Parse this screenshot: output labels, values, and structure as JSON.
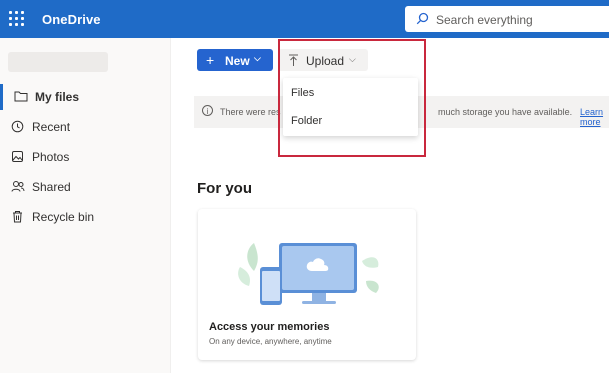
{
  "app": {
    "title": "OneDrive"
  },
  "search": {
    "placeholder": "Search everything"
  },
  "nav": {
    "items": [
      {
        "label": "My files",
        "icon": "folder-icon",
        "active": true
      },
      {
        "label": "Recent",
        "icon": "clock-icon",
        "active": false
      },
      {
        "label": "Photos",
        "icon": "photo-icon",
        "active": false
      },
      {
        "label": "Shared",
        "icon": "people-icon",
        "active": false
      },
      {
        "label": "Recycle bin",
        "icon": "trash-icon",
        "active": false
      }
    ]
  },
  "toolbar": {
    "new_label": "New",
    "upload_label": "Upload"
  },
  "upload_menu": {
    "items": [
      "Files",
      "Folder"
    ]
  },
  "notice": {
    "text_start": "There were res",
    "text_end": "much storage you have available.",
    "link": "Learn more"
  },
  "foryou": {
    "heading": "For you",
    "card_title": "Access your memories",
    "card_subtitle": "On any device, anywhere, anytime"
  },
  "colors": {
    "brand": "#1f6bc7",
    "primary_button": "#2564cf",
    "highlight": "#c9283d"
  }
}
